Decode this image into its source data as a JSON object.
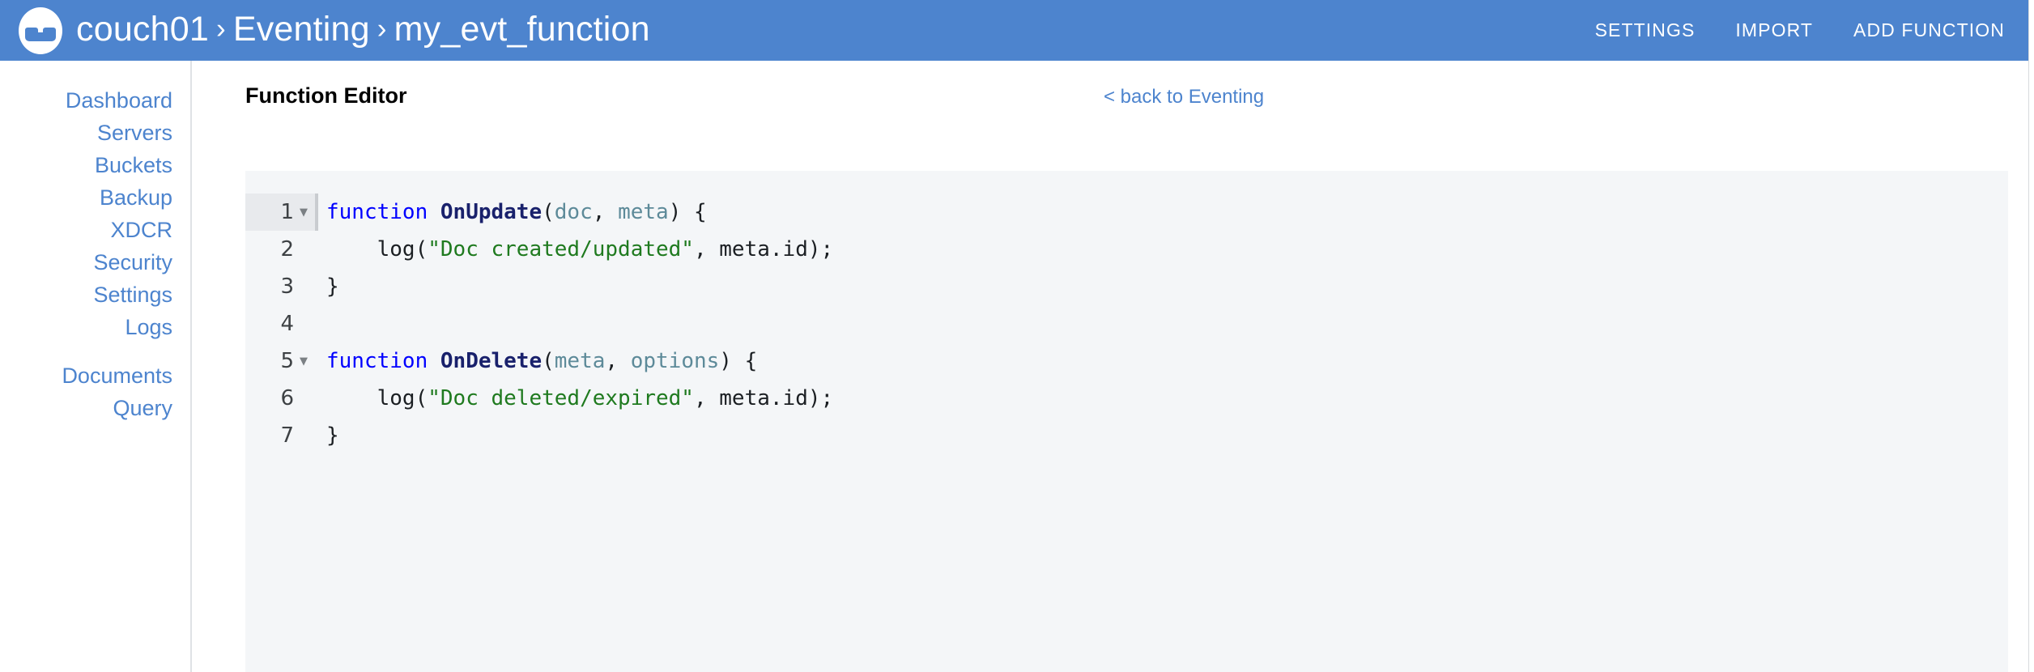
{
  "header": {
    "logo_icon": "couchbase-logo-icon",
    "breadcrumb": {
      "cluster": "couch01",
      "section": "Eventing",
      "current": "my_evt_function",
      "separator": "›"
    },
    "actions": [
      {
        "label": "SETTINGS",
        "name": "settings"
      },
      {
        "label": "IMPORT",
        "name": "import"
      },
      {
        "label": "ADD FUNCTION",
        "name": "add-function"
      }
    ],
    "background_color": "#4d84ce",
    "text_color": "#ffffff"
  },
  "sidebar": {
    "items": [
      {
        "label": "Dashboard"
      },
      {
        "label": "Servers"
      },
      {
        "label": "Buckets"
      },
      {
        "label": "Backup"
      },
      {
        "label": "XDCR"
      },
      {
        "label": "Security"
      },
      {
        "label": "Settings"
      },
      {
        "label": "Logs"
      }
    ],
    "items_group2": [
      {
        "label": "Documents"
      },
      {
        "label": "Query"
      }
    ],
    "link_color": "#4d84ce"
  },
  "main": {
    "page_title": "Function Editor",
    "back_link": "< back to Eventing",
    "search_icon": "search-icon"
  },
  "editor": {
    "background": "#f4f6f8",
    "active_line": 1,
    "lines": [
      {
        "number": "1",
        "fold": true,
        "cursor": true,
        "tokens": [
          {
            "t": "function",
            "c": "kw"
          },
          {
            "t": " ",
            "c": "plain"
          },
          {
            "t": "OnUpdate",
            "c": "fn"
          },
          {
            "t": "(",
            "c": "plain"
          },
          {
            "t": "doc",
            "c": "param"
          },
          {
            "t": ", ",
            "c": "plain"
          },
          {
            "t": "meta",
            "c": "param"
          },
          {
            "t": ") {",
            "c": "plain"
          }
        ]
      },
      {
        "number": "2",
        "fold": false,
        "cursor": false,
        "tokens": [
          {
            "t": "    log(",
            "c": "plain"
          },
          {
            "t": "\"Doc created/updated\"",
            "c": "str"
          },
          {
            "t": ", meta.id);",
            "c": "plain"
          }
        ]
      },
      {
        "number": "3",
        "fold": false,
        "cursor": false,
        "tokens": [
          {
            "t": "}",
            "c": "plain"
          }
        ]
      },
      {
        "number": "4",
        "fold": false,
        "cursor": false,
        "tokens": [
          {
            "t": "",
            "c": "plain"
          }
        ]
      },
      {
        "number": "5",
        "fold": true,
        "cursor": false,
        "tokens": [
          {
            "t": "function",
            "c": "kw"
          },
          {
            "t": " ",
            "c": "plain"
          },
          {
            "t": "OnDelete",
            "c": "fn"
          },
          {
            "t": "(",
            "c": "plain"
          },
          {
            "t": "meta",
            "c": "param"
          },
          {
            "t": ", ",
            "c": "plain"
          },
          {
            "t": "options",
            "c": "param"
          },
          {
            "t": ") {",
            "c": "plain"
          }
        ]
      },
      {
        "number": "6",
        "fold": false,
        "cursor": false,
        "tokens": [
          {
            "t": "    log(",
            "c": "plain"
          },
          {
            "t": "\"Doc deleted/expired\"",
            "c": "str"
          },
          {
            "t": ", meta.id);",
            "c": "plain"
          }
        ]
      },
      {
        "number": "7",
        "fold": false,
        "cursor": false,
        "tokens": [
          {
            "t": "}",
            "c": "plain"
          }
        ]
      }
    ],
    "syntax_colors": {
      "keyword": "#0000ff",
      "function_name": "#19216c",
      "parameter": "#5d8a99",
      "string": "#1f7a1f",
      "plain": "#1b1f23"
    }
  }
}
